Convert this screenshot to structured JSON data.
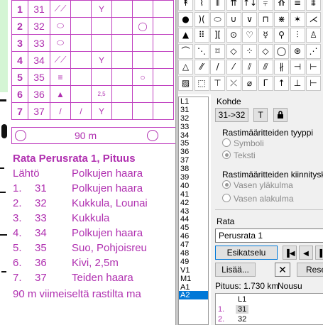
{
  "description_sheet": {
    "rows": [
      {
        "num": "1",
        "code": "31",
        "sym_c": "⟋⟋",
        "sym_d": "",
        "sym_e": "Y",
        "sym_g": ""
      },
      {
        "num": "2",
        "code": "32",
        "sym_c": "⬭",
        "sym_d": "",
        "sym_e": "",
        "sym_g": "◯"
      },
      {
        "num": "3",
        "code": "33",
        "sym_c": "⬭",
        "sym_d": "",
        "sym_e": "",
        "sym_g": ""
      },
      {
        "num": "4",
        "code": "34",
        "sym_c": "⟋⟋",
        "sym_d": "",
        "sym_e": "Y",
        "sym_g": ""
      },
      {
        "num": "5",
        "code": "35",
        "sym_c": "≡",
        "sym_d": "",
        "sym_e": "",
        "sym_g": "○"
      },
      {
        "num": "6",
        "code": "36",
        "sym_c": "▲",
        "sym_d": "",
        "sym_e": "2,5",
        "sym_g": ""
      },
      {
        "num": "7",
        "code": "37",
        "sym_c": "/",
        "sym_d": "/",
        "sym_e": "Y",
        "sym_g": ""
      }
    ],
    "finish_distance": "90 m",
    "course_title": "Rata Perusrata 1,  Pituus",
    "legs": [
      {
        "n": "Lähtö",
        "code": "",
        "text": "Polkujen haara"
      },
      {
        "n": "1.",
        "code": "31",
        "text": "Polkujen haara"
      },
      {
        "n": "2.",
        "code": "32",
        "text": "Kukkula, Lounai"
      },
      {
        "n": "3.",
        "code": "33",
        "text": "Kukkula"
      },
      {
        "n": "4.",
        "code": "34",
        "text": "Polkujen haara"
      },
      {
        "n": "5.",
        "code": "35",
        "text": "Suo, Pohjoisreu"
      },
      {
        "n": "6.",
        "code": "36",
        "text": "Kivi, 2,5m"
      },
      {
        "n": "7.",
        "code": "37",
        "text": "Teiden haara"
      }
    ],
    "footer": "90 m viimeiseltä rastilta ma"
  },
  "palette": {
    "rows": [
      [
        "↟",
        "⌇",
        "⫴",
        "⇈",
        "↑↓",
        "⫧",
        "⟰",
        "≡",
        "⩩"
      ],
      [
        "●",
        ")(",
        "⬭",
        "∪",
        "∨",
        "⊓",
        "⋇",
        "✶",
        "⋌"
      ],
      [
        "▲",
        "⠿",
        "][",
        "⊙",
        "♡",
        "☿",
        "⚲",
        "⫶",
        "♙"
      ],
      [
        "⌒",
        "⋱",
        "⌑",
        "◇",
        "⁘",
        "◇",
        "◯",
        "⊛",
        "⋰"
      ],
      [
        "△",
        "⁄⁄",
        "/",
        "⁄",
        "⫽",
        "⫻",
        "∦",
        "⊣",
        "⊢"
      ],
      [
        "▨",
        "⬚",
        "⊤",
        "⤫",
        "⌀",
        "Γ",
        "↑",
        "⊥",
        "⊢"
      ]
    ]
  },
  "control_list": {
    "items": [
      "L1",
      "31",
      "32",
      "33",
      "34",
      "35",
      "36",
      "37",
      "38",
      "39",
      "40",
      "41",
      "42",
      "43",
      "44",
      "45",
      "46",
      "47",
      "48",
      "49",
      "V1",
      "M1",
      "A1",
      "A2"
    ],
    "selected": "A2"
  },
  "props": {
    "kohde_label": "Kohde",
    "kohde_value": "31->32",
    "t_button": "T",
    "lock_icon": "lock-icon",
    "type_section": "Rastimääritteiden tyyppi",
    "radio_symboli": "Symboli",
    "radio_teksti": "Teksti",
    "attach_section": "Rastimääritteiden kiinnityskohta",
    "radio_upper": "Vasen yläkulma",
    "radio_lower": "Vasen alakulma",
    "rata_label": "Rata",
    "rata_value": "Perusrata 1",
    "preview_button": "Esikatselu",
    "add_button": "Lisää...",
    "reset_button": "Reset",
    "length_text": "Pituus: 1.730 km",
    "climb_text": "Nousu",
    "preview_rows": [
      {
        "n": "",
        "code": "L1"
      },
      {
        "n": "1.",
        "code": "31"
      },
      {
        "n": "2.",
        "code": "32"
      }
    ]
  },
  "colors": {
    "course_purple": "#b030b0",
    "selection_blue": "#0078d7"
  }
}
